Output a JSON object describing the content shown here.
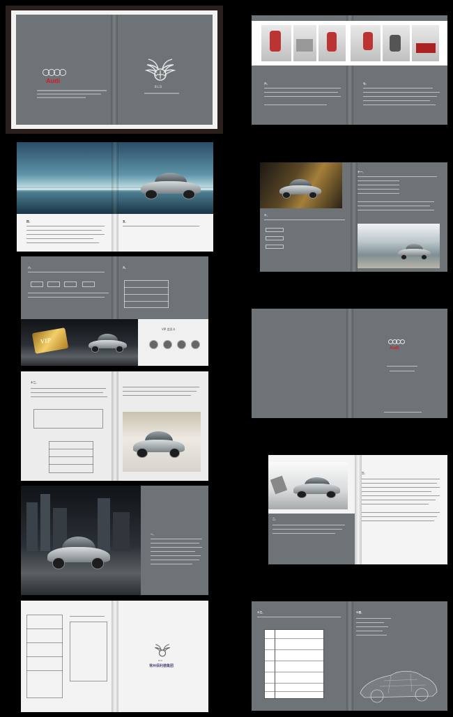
{
  "cover": {
    "audi_wordmark": "Audi",
    "bld_logo_text": "BLD"
  },
  "spreads": {
    "membership_cover": {
      "audi_wordmark": "Audi"
    },
    "vip": {
      "card_title": "VIP 会员卡",
      "card_text": "VIP"
    },
    "service": {
      "heading_left": "六、",
      "heading_right": "七、"
    },
    "back": {
      "company_name": "常州佰利德集团",
      "bld_logo_text": "BLD"
    }
  },
  "colors": {
    "page_gray": "#6d7377",
    "audi_red": "#d51c22",
    "background": "#000000"
  },
  "icons": [
    "audi-rings-icon",
    "bld-winged-logo-icon"
  ]
}
